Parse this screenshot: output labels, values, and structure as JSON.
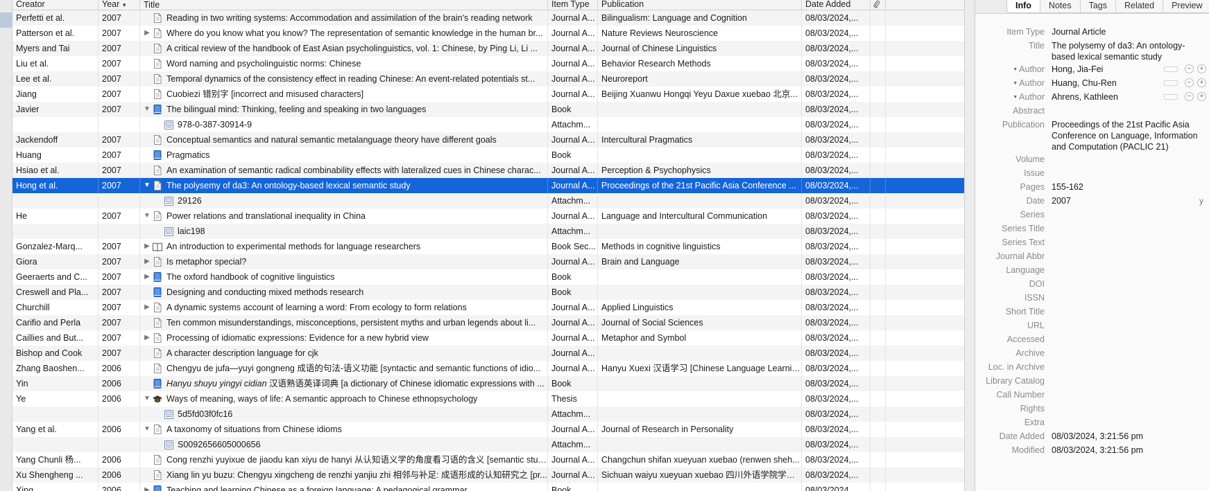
{
  "columns": {
    "creator": "Creator",
    "year": "Year",
    "title": "Title",
    "item_type": "Item Type",
    "publication": "Publication",
    "date_added": "Date Added"
  },
  "rows": [
    {
      "creator": "Perfetti et al.",
      "year": "2007",
      "twisty": "",
      "icon": "article",
      "child": false,
      "title": "Reading in two writing systems: Accommodation and assimilation of the brain's reading network",
      "type": "Journal A...",
      "pub": "Bilingualism: Language and Cognition",
      "date": "08/03/2024,...",
      "selected": false
    },
    {
      "creator": "Patterson et al.",
      "year": "2007",
      "twisty": "closed",
      "icon": "article",
      "child": false,
      "title": "Where do you know what you know? The representation of semantic knowledge in the human br...",
      "type": "Journal A...",
      "pub": "Nature Reviews Neuroscience",
      "date": "08/03/2024,...",
      "selected": false
    },
    {
      "creator": "Myers and Tai",
      "year": "2007",
      "twisty": "",
      "icon": "article",
      "child": false,
      "title": "A critical review of the handbook of East Asian psycholinguistics, vol. 1: Chinese, by Ping Li, Li ...",
      "type": "Journal A...",
      "pub": "Journal of Chinese Linguistics",
      "date": "08/03/2024,...",
      "selected": false
    },
    {
      "creator": "Liu et al.",
      "year": "2007",
      "twisty": "",
      "icon": "article",
      "child": false,
      "title": "Word naming and psycholinguistic norms: Chinese",
      "type": "Journal A...",
      "pub": "Behavior Research Methods",
      "date": "08/03/2024,...",
      "selected": false
    },
    {
      "creator": "Lee et al.",
      "year": "2007",
      "twisty": "",
      "icon": "article",
      "child": false,
      "title": "Temporal dynamics of the consistency effect in reading Chinese: An event-related potentials st...",
      "type": "Journal A...",
      "pub": "Neuroreport",
      "date": "08/03/2024,...",
      "selected": false
    },
    {
      "creator": "Jiang",
      "year": "2007",
      "twisty": "",
      "icon": "article",
      "child": false,
      "title": "Cuobiezi 错别字 [incorrect and misused characters]",
      "type": "Journal A...",
      "pub": "Beijing Xuanwu Hongqi Yeyu Daxue xuebao 北京...",
      "date": "08/03/2024,...",
      "selected": false
    },
    {
      "creator": "Javier",
      "year": "2007",
      "twisty": "open",
      "icon": "book",
      "child": false,
      "title": "The bilingual mind: Thinking, feeling and speaking in two languages",
      "type": "Book",
      "pub": "",
      "date": "08/03/2024,...",
      "selected": false
    },
    {
      "creator": "",
      "year": "",
      "twisty": "",
      "icon": "attachment",
      "child": true,
      "title": "978-0-387-30914-9",
      "type": "Attachm...",
      "pub": "",
      "date": "08/03/2024,...",
      "selected": false
    },
    {
      "creator": "Jackendoff",
      "year": "2007",
      "twisty": "",
      "icon": "article",
      "child": false,
      "title": "Conceptual semantics and natural semantic metalanguage theory have different goals",
      "type": "Journal A...",
      "pub": "Intercultural Pragmatics",
      "date": "08/03/2024,...",
      "selected": false
    },
    {
      "creator": "Huang",
      "year": "2007",
      "twisty": "",
      "icon": "book",
      "child": false,
      "title": "Pragmatics",
      "type": "Book",
      "pub": "",
      "date": "08/03/2024,...",
      "selected": false
    },
    {
      "creator": "Hsiao et al.",
      "year": "2007",
      "twisty": "",
      "icon": "article",
      "child": false,
      "title": "An examination of semantic radical combinability effects with lateralized cues in Chinese charac...",
      "type": "Journal A...",
      "pub": "Perception & Psychophysics",
      "date": "08/03/2024,...",
      "selected": false
    },
    {
      "creator": "Hong et al.",
      "year": "2007",
      "twisty": "open",
      "icon": "article",
      "child": false,
      "title": "The polysemy of da3: An ontology-based lexical semantic study",
      "type": "Journal A...",
      "pub": "Proceedings of the 21st Pacific Asia Conference ...",
      "date": "08/03/2024,...",
      "selected": true
    },
    {
      "creator": "",
      "year": "",
      "twisty": "",
      "icon": "attachment",
      "child": true,
      "title": "29126",
      "type": "Attachm...",
      "pub": "",
      "date": "08/03/2024,...",
      "selected": false
    },
    {
      "creator": "He",
      "year": "2007",
      "twisty": "open",
      "icon": "article",
      "child": false,
      "title": "Power relations and translational inequality in China",
      "type": "Journal A...",
      "pub": "Language and Intercultural Communication",
      "date": "08/03/2024,...",
      "selected": false
    },
    {
      "creator": "",
      "year": "",
      "twisty": "",
      "icon": "attachment",
      "child": true,
      "title": "laic198",
      "type": "Attachm...",
      "pub": "",
      "date": "08/03/2024,...",
      "selected": false
    },
    {
      "creator": "Gonzalez-Marq...",
      "year": "2007",
      "twisty": "closed",
      "icon": "booksection",
      "child": false,
      "title": "An introduction to experimental methods for language researchers",
      "type": "Book Sec...",
      "pub": "Methods in cognitive linguistics",
      "date": "08/03/2024,...",
      "selected": false
    },
    {
      "creator": "Giora",
      "year": "2007",
      "twisty": "closed",
      "icon": "article",
      "child": false,
      "title": "Is metaphor special?",
      "type": "Journal A...",
      "pub": "Brain and Language",
      "date": "08/03/2024,...",
      "selected": false
    },
    {
      "creator": "Geeraerts and C...",
      "year": "2007",
      "twisty": "closed",
      "icon": "book",
      "child": false,
      "title": "The oxford handbook of cognitive linguistics",
      "type": "Book",
      "pub": "",
      "date": "08/03/2024,...",
      "selected": false
    },
    {
      "creator": "Creswell and Pla...",
      "year": "2007",
      "twisty": "",
      "icon": "book",
      "child": false,
      "title": "Designing and conducting mixed methods research",
      "type": "Book",
      "pub": "",
      "date": "08/03/2024,...",
      "selected": false
    },
    {
      "creator": "Churchill",
      "year": "2007",
      "twisty": "closed",
      "icon": "article",
      "child": false,
      "title": "A dynamic systems account of learning a word: From ecology to form relations",
      "type": "Journal A...",
      "pub": "Applied Linguistics",
      "date": "08/03/2024,...",
      "selected": false
    },
    {
      "creator": "Carifio and Perla",
      "year": "2007",
      "twisty": "",
      "icon": "article",
      "child": false,
      "title": "Ten common misunderstandings, misconceptions, persistent myths and urban legends about li...",
      "type": "Journal A...",
      "pub": "Journal of Social Sciences",
      "date": "08/03/2024,...",
      "selected": false
    },
    {
      "creator": "Caillies and But...",
      "year": "2007",
      "twisty": "closed",
      "icon": "article",
      "child": false,
      "title": "Processing of idiomatic expressions: Evidence for a new hybrid view",
      "type": "Journal A...",
      "pub": "Metaphor and Symbol",
      "date": "08/03/2024,...",
      "selected": false
    },
    {
      "creator": "Bishop and Cook",
      "year": "2007",
      "twisty": "",
      "icon": "article",
      "child": false,
      "title": "A character description language for cjk",
      "type": "Journal A...",
      "pub": "",
      "date": "08/03/2024,...",
      "selected": false
    },
    {
      "creator": "Zhang Baoshen...",
      "year": "2006",
      "twisty": "",
      "icon": "article",
      "child": false,
      "title": "Chengyu de jufa—yuyi gongneng 成语的句法-语义功能 [syntactic and semantic functions of idio...",
      "type": "Journal A...",
      "pub": "Hanyu Xuexi 汉语学习 [Chinese Language Learning]",
      "date": "08/03/2024,...",
      "selected": false
    },
    {
      "creator": "Yin",
      "year": "2006",
      "twisty": "",
      "icon": "book",
      "child": false,
      "title": "Hanyu shuyu yingyi cidian 汉语熟语英译词典 [a dictionary of Chinese idiomatic expressions with ...",
      "italic_part": "Hanyu shuyu yingyi cidian",
      "type": "Book",
      "pub": "",
      "date": "08/03/2024,...",
      "selected": false
    },
    {
      "creator": "Ye",
      "year": "2006",
      "twisty": "open",
      "icon": "thesis",
      "child": false,
      "title": "Ways of meaning, ways of life: A semantic approach to Chinese ethnopsychology",
      "type": "Thesis",
      "pub": "",
      "date": "08/03/2024,...",
      "selected": false
    },
    {
      "creator": "",
      "year": "",
      "twisty": "",
      "icon": "attachment",
      "child": true,
      "title": "5d5fd03f0fc16",
      "type": "Attachm...",
      "pub": "",
      "date": "08/03/2024,...",
      "selected": false
    },
    {
      "creator": "Yang et al.",
      "year": "2006",
      "twisty": "open",
      "icon": "article",
      "child": false,
      "title": "A taxonomy of situations from Chinese idioms",
      "type": "Journal A...",
      "pub": "Journal of Research in Personality",
      "date": "08/03/2024,...",
      "selected": false
    },
    {
      "creator": "",
      "year": "",
      "twisty": "",
      "icon": "attachment",
      "child": true,
      "title": "S0092656605000656",
      "type": "Attachm...",
      "pub": "",
      "date": "08/03/2024,...",
      "selected": false
    },
    {
      "creator": "Yang Chunli 杨...",
      "year": "2006",
      "twisty": "",
      "icon": "article",
      "child": false,
      "title": "Cong renzhi yuyixue de jiaodu kan xiyu de hanyi 从认知语义学的角度看习语的含义 [semantic studi...",
      "type": "Journal A...",
      "pub": "Changchun shifan xueyuan xuebao (renwen sheh...",
      "date": "08/03/2024,...",
      "selected": false
    },
    {
      "creator": "Xu Shengheng ...",
      "year": "2006",
      "twisty": "",
      "icon": "article",
      "child": false,
      "title": "Xiang lin yu buzu: Chengyu xingcheng de renzhi yanjiu zhi 相邻与补足: 成语形成的认知研究之 [pr...",
      "type": "Journal A...",
      "pub": "Sichuan waiyu xueyuan xuebao 四川外语学院学报 ...",
      "date": "08/03/2024,...",
      "selected": false
    },
    {
      "creator": "Xing",
      "year": "2006",
      "twisty": "closed",
      "icon": "book",
      "child": false,
      "title": "Teaching and learning Chinese as a foreign language: A pedagogical grammar",
      "type": "Book",
      "pub": "",
      "date": "08/03/2024,...",
      "selected": false
    }
  ],
  "item_pane": {
    "tabs": [
      "Info",
      "Notes",
      "Tags",
      "Related",
      "Preview"
    ],
    "active_tab": "Info",
    "fields": [
      {
        "label": "Item Type",
        "value": "Journal Article"
      },
      {
        "label": "Title",
        "value": "The polysemy of da3: An ontology-based lexical semantic study"
      },
      {
        "label": "Author",
        "value": "Hong, Jia-Fei",
        "creator": true
      },
      {
        "label": "Author",
        "value": "Huang, Chu-Ren",
        "creator": true
      },
      {
        "label": "Author",
        "value": "Ahrens, Kathleen",
        "creator": true,
        "last": true
      },
      {
        "label": "Abstract",
        "value": ""
      },
      {
        "label": "Publication",
        "value": "Proceedings of the 21st Pacific Asia Conference on Language, Information and Computation (PACLIC 21)"
      },
      {
        "label": "Volume",
        "value": ""
      },
      {
        "label": "Issue",
        "value": ""
      },
      {
        "label": "Pages",
        "value": "155-162"
      },
      {
        "label": "Date",
        "value": "2007",
        "flag": "y"
      },
      {
        "label": "Series",
        "value": ""
      },
      {
        "label": "Series Title",
        "value": ""
      },
      {
        "label": "Series Text",
        "value": ""
      },
      {
        "label": "Journal Abbr",
        "value": ""
      },
      {
        "label": "Language",
        "value": ""
      },
      {
        "label": "DOI",
        "value": ""
      },
      {
        "label": "ISSN",
        "value": ""
      },
      {
        "label": "Short Title",
        "value": ""
      },
      {
        "label": "URL",
        "value": ""
      },
      {
        "label": "Accessed",
        "value": ""
      },
      {
        "label": "Archive",
        "value": ""
      },
      {
        "label": "Loc. in Archive",
        "value": ""
      },
      {
        "label": "Library Catalog",
        "value": ""
      },
      {
        "label": "Call Number",
        "value": ""
      },
      {
        "label": "Rights",
        "value": ""
      },
      {
        "label": "Extra",
        "value": ""
      },
      {
        "label": "Date Added",
        "value": "08/03/2024, 3:21:56 pm"
      },
      {
        "label": "Modified",
        "value": "08/03/2024, 3:21:56 pm"
      }
    ]
  },
  "colors": {
    "selection": "#1565d8",
    "stripe": "#f4f4f4"
  }
}
